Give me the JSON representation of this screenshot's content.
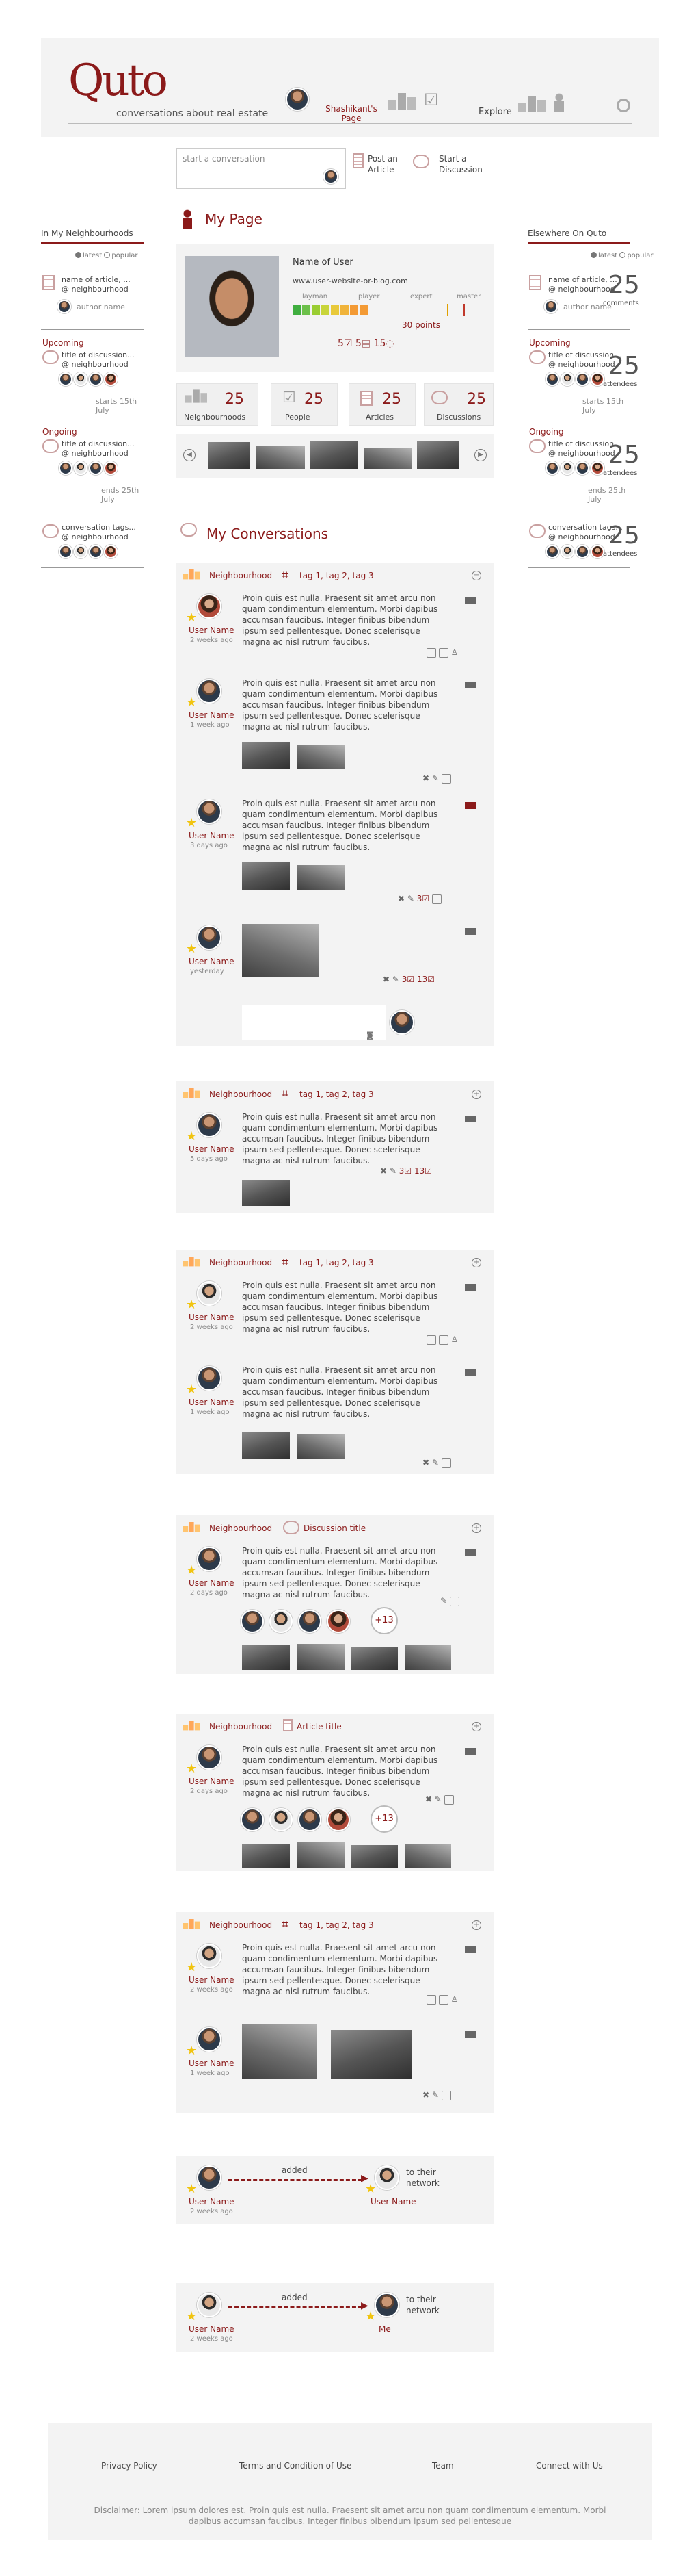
{
  "header": {
    "logo": "Quto",
    "tagline": "conversations about real estate",
    "user_name": "Shashikant's Page",
    "explore": "Explore"
  },
  "compose": {
    "placeholder": "start a conversation",
    "post_article": "Post an Article",
    "start_discussion": "Start a Discussion"
  },
  "left_col": {
    "title": "In My Neighbourhoods",
    "latest": "latest",
    "popular": "popular",
    "article_title": "name of article, ...",
    "article_hood": "@ neighbourhood",
    "author": "author name",
    "upcoming_label": "Upcoming",
    "upcoming_title": "title of discussion...",
    "upcoming_hood": "@ neighbourhood",
    "upcoming_date": "starts 15th July",
    "ongoing_label": "Ongoing",
    "ongoing_title": "title of discussion...",
    "ongoing_hood": "@ neighbourhood",
    "ongoing_date": "ends 25th July",
    "tags_title": "conversation tags...",
    "tags_hood": "@ neighbourhood"
  },
  "right_col": {
    "title": "Elsewhere On Quto",
    "latest": "latest",
    "popular": "popular",
    "article_title": "name of article, ...",
    "article_hood": "@ neighbourhood",
    "author": "author name",
    "article_num": "25",
    "article_num_label": "comments",
    "upcoming_label": "Upcoming",
    "upcoming_title": "title of discussion...",
    "upcoming_hood": "@ neighbourhood",
    "upcoming_num": "25",
    "upcoming_num_label": "attendees",
    "upcoming_date": "starts 15th July",
    "ongoing_label": "Ongoing",
    "ongoing_title": "title of discussion...",
    "ongoing_hood": "@ neighbourhood",
    "ongoing_num": "25",
    "ongoing_num_label": "attendees",
    "ongoing_date": "ends 25th July",
    "tags_title": "conversation tags...",
    "tags_hood": "@ neighbourhood",
    "tags_num": "25",
    "tags_num_label": "attendees"
  },
  "profile": {
    "page_title": "My Page",
    "name": "Name of User",
    "website": "www.user-website-or-blog.com",
    "levels": [
      "layman",
      "player",
      "expert",
      "master"
    ],
    "points": "30 points",
    "level_fraction": 0.42,
    "stat1": "5",
    "stat2": "5",
    "stat3": "15"
  },
  "stats": [
    {
      "num": "25",
      "label": "Neighbourhoods"
    },
    {
      "num": "25",
      "label": "People"
    },
    {
      "num": "25",
      "label": "Articles"
    },
    {
      "num": "25",
      "label": "Discussions"
    }
  ],
  "conversations": {
    "title": "My Conversations",
    "neighbourhood": "Neighbourhood",
    "tags": "tag 1, tag 2, tag 3",
    "discussion_title": "Discussion title",
    "article_title": "Article title",
    "body": "Proin quis est nulla. Praesent sit amet arcu non quam condimentum elementum. Morbi dapibus accumsan faucibus. Integer finibus bibendum ipsum sed pellentesque. Donec scelerisque magna ac nisl rutrum faucibus.",
    "user_name": "User Name",
    "ago_2w": "2 weeks ago",
    "ago_1w": "1 week ago",
    "ago_3d": "3 days ago",
    "ago_5d": "5 days ago",
    "ago_2d": "2 days ago",
    "yesterday": "yesterday",
    "count3": "3",
    "count13": "13",
    "plus13": "+13",
    "added": "added",
    "to_network": "to their network",
    "me": "Me"
  },
  "footer": {
    "privacy": "Privacy Policy",
    "terms": "Terms and Condition of Use",
    "team": "Team",
    "connect": "Connect with Us",
    "disclaimer": "Disclaimer: Lorem ipsum dolores est. Proin quis est nulla. Praesent sit amet arcu non quam condimentum elementum. Morbi dapibus accumsan faucibus. Integer finibus bibendum ipsum sed pellentesque"
  }
}
